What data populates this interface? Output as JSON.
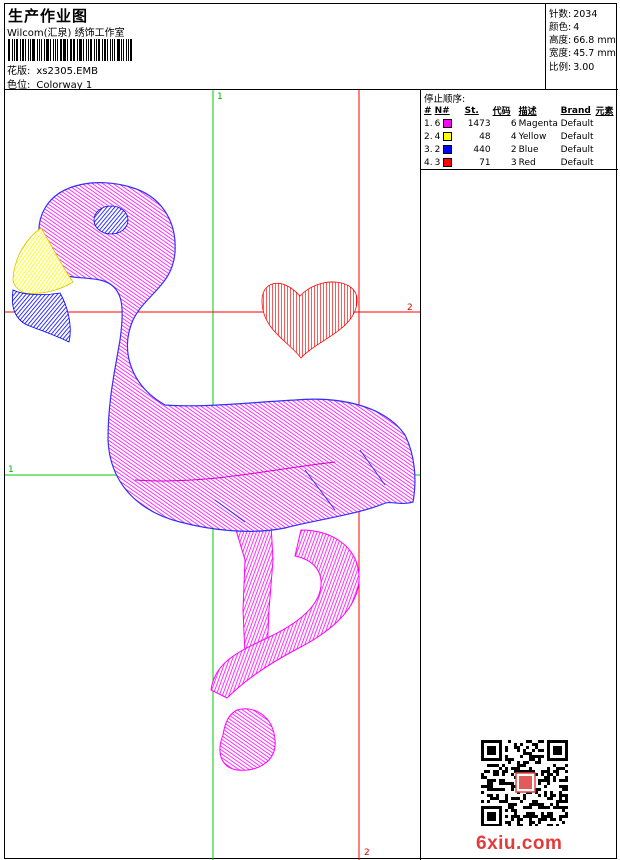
{
  "header": {
    "title": "生产作业图",
    "company": "Wilcom(汇泉) 绣饰工作室",
    "design_label": "花版:",
    "design_value": "xs2305.EMB",
    "colorway_label": "色位:",
    "colorway_value": "Colorway 1"
  },
  "stats": [
    {
      "label": "针数:",
      "value": "2034"
    },
    {
      "label": "颜色:",
      "value": "4"
    },
    {
      "label": "高度:",
      "value": "66.8 mm"
    },
    {
      "label": "宽度:",
      "value": "45.7 mm"
    },
    {
      "label": "比例:",
      "value": "3.00"
    }
  ],
  "stops": {
    "title": "停止顺序:",
    "columns": [
      "#",
      "N#",
      "St.",
      "代码",
      "描述",
      "Brand",
      "元素"
    ],
    "rows": [
      {
        "idx": "1.",
        "n": "6",
        "color": "#ff00ff",
        "stitches": "1473",
        "code": "6",
        "desc": "Magenta",
        "brand": "Default"
      },
      {
        "idx": "2.",
        "n": "4",
        "color": "#ffff00",
        "stitches": "48",
        "code": "4",
        "desc": "Yellow",
        "brand": "Default"
      },
      {
        "idx": "3.",
        "n": "2",
        "color": "#0000ff",
        "stitches": "440",
        "code": "2",
        "desc": "Blue",
        "brand": "Default"
      },
      {
        "idx": "4.",
        "n": "3",
        "color": "#ff0000",
        "stitches": "71",
        "code": "3",
        "desc": "Red",
        "brand": "Default"
      }
    ]
  },
  "guides": {
    "v_green_label_top": "1",
    "v_red_label_bottom": "2",
    "h_red_label_right": "2",
    "h_green_label_left": "1"
  },
  "colors": {
    "magenta": "#ff00ff",
    "yellow": "#ffff00",
    "blue": "#0000ff",
    "red": "#ff0000",
    "guide_green": "#00cc00",
    "guide_red": "#ff0000"
  },
  "watermark": "6xiu.com"
}
